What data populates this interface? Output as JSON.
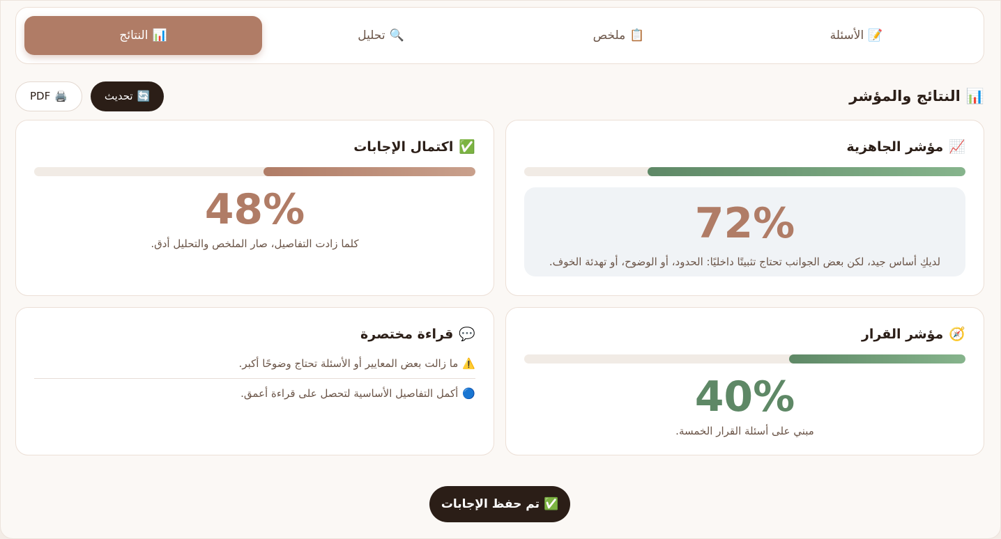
{
  "tabs": [
    {
      "icon": "📝",
      "label": "الأسئلة",
      "active": false
    },
    {
      "icon": "📋",
      "label": "ملخص",
      "active": false
    },
    {
      "icon": "🔍",
      "label": "تحليل",
      "active": false
    },
    {
      "icon": "📊",
      "label": "النتائج",
      "active": true
    }
  ],
  "header": {
    "icon": "📊",
    "title": "النتائج والمؤشر",
    "refresh_icon": "🔄",
    "refresh_label": "تحديث",
    "pdf_icon": "🖨️",
    "pdf_label": "PDF"
  },
  "readiness": {
    "icon": "📈",
    "title": "مؤشر الجاهزية",
    "value_text": "72%",
    "value": 0.72,
    "description": "لديكِ أساس جيد، لكن بعض الجوانب تحتاج تثبيتًا داخليًا: الحدود، أو الوضوح، أو تهدئة الخوف."
  },
  "completion": {
    "icon": "✅",
    "title": "اكتمال الإجابات",
    "value_text": "48%",
    "value": 0.48,
    "description": "كلما زادت التفاصيل، صار الملخص والتحليل أدق."
  },
  "decision": {
    "icon": "🧭",
    "title": "مؤشر القرار",
    "value_text": "40%",
    "value": 0.4,
    "description": "مبني على أسئلة القرار الخمسة."
  },
  "reading": {
    "icon": "💬",
    "title": "قراءة مختصرة",
    "items": [
      {
        "icon": "⚠️",
        "text": "ما زالت بعض المعايير أو الأسئلة تحتاج وضوحًا أكبر."
      },
      {
        "icon": "🔵",
        "text": "أكمل التفاصيل الأساسية لتحصل على قراءة أعمق."
      }
    ]
  },
  "save": {
    "icon": "✅",
    "label": "تم حفظ الإجابات"
  },
  "colors": {
    "accent": "#b07c66",
    "dark": "#2b1e17",
    "green": "#5e8866"
  }
}
